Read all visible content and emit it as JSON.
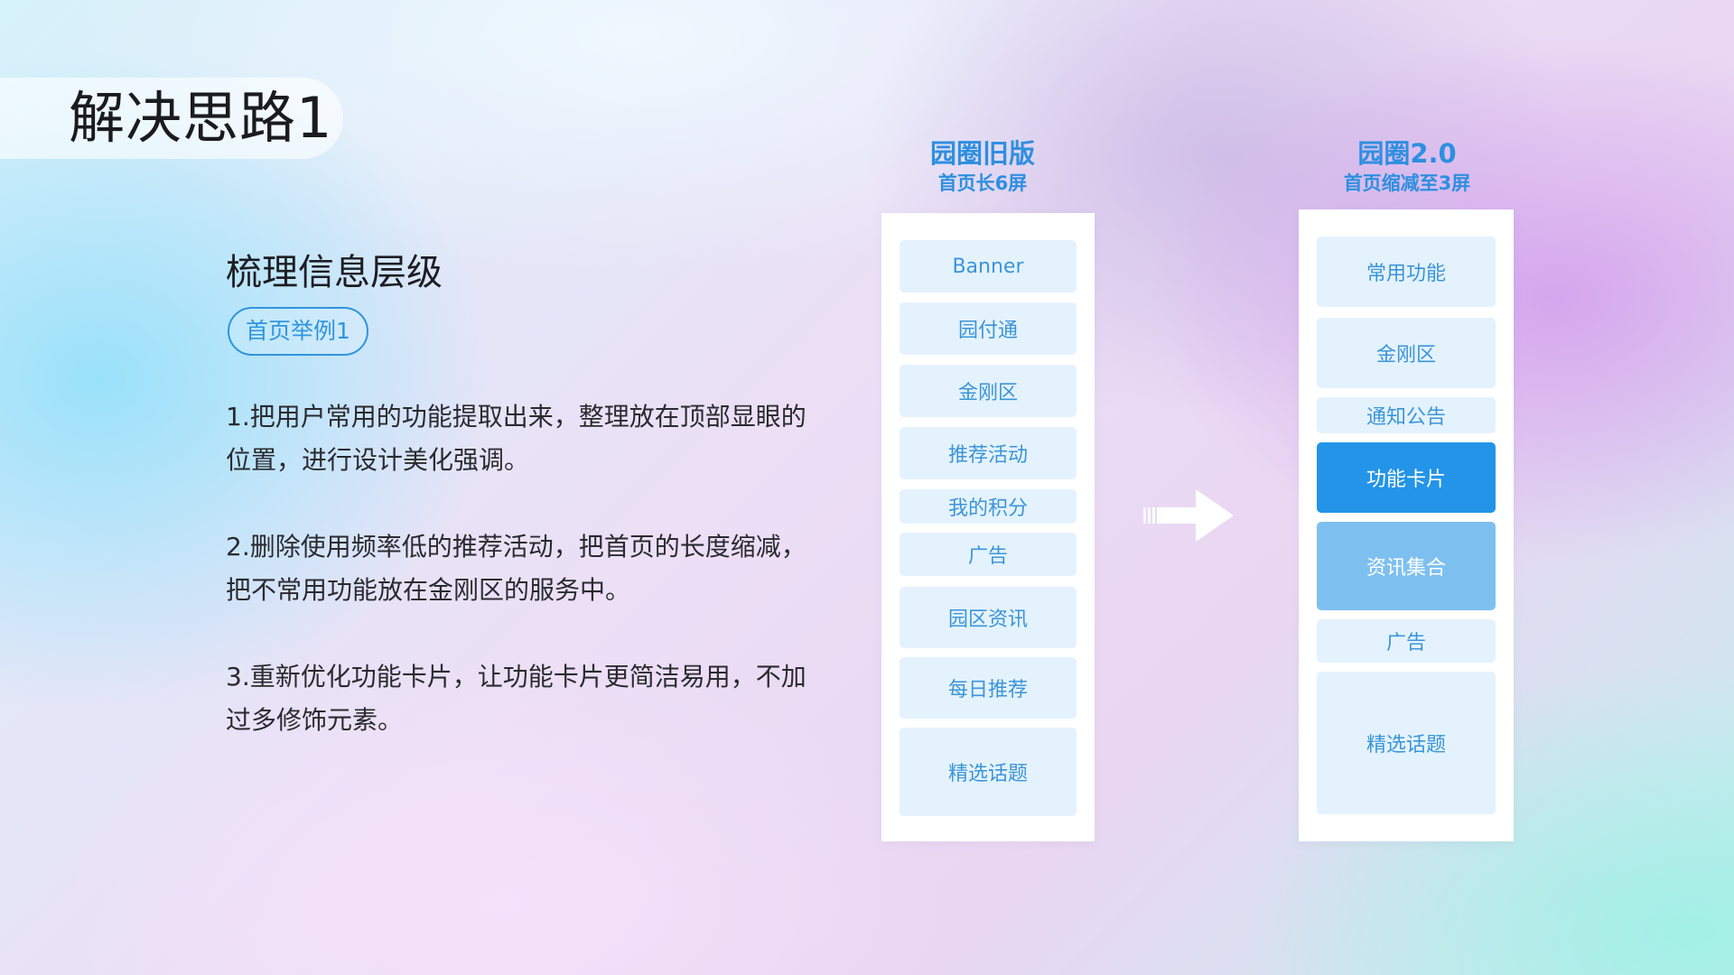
{
  "page_title": "解决思路1",
  "section_heading": "梳理信息层级",
  "example_tag": "首页举例1",
  "points": [
    "1.把用户常用的功能提取出来，整理放在顶部显眼的位置，进行设计美化强调。",
    "2.删除使用频率低的推荐活动，把首页的长度缩减，把不常用功能放在金刚区的服务中。",
    "3.重新优化功能卡片，让功能卡片更简洁易用，不加过多修饰元素。"
  ],
  "old_version": {
    "title": "园圈旧版",
    "subtitle": "首页长6屏",
    "modules": [
      "Banner",
      "园付通",
      "金刚区",
      "推荐活动",
      "我的积分",
      "广告",
      "园区资讯",
      "每日推荐",
      "精选话题"
    ]
  },
  "new_version": {
    "title": "园圈2.0",
    "subtitle": "首页缩减至3屏",
    "modules": [
      "常用功能",
      "金刚区",
      "通知公告",
      "功能卡片",
      "资讯集合",
      "广告",
      "精选话题"
    ]
  },
  "colors": {
    "accent_blue": "#2394e8",
    "light_blue": "#7dc0f0",
    "module_bg": "#e4f2fd",
    "module_text": "#3a95d8"
  },
  "icons": {
    "arrow": "right-arrow-icon"
  }
}
